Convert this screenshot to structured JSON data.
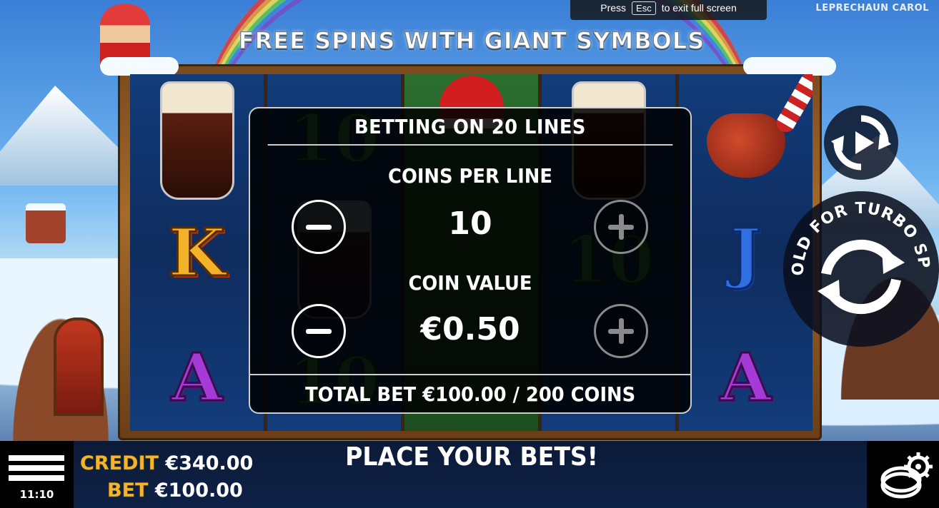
{
  "screen": {
    "brand": "LEPRECHAUN CAROL",
    "title": "FREE SPINS WITH GIANT SYMBOLS"
  },
  "fullscreen_hint": {
    "before": "Press",
    "key": "Esc",
    "after": "to exit full screen"
  },
  "reels": {
    "columns": [
      {
        "symbols": [
          "beer-glass",
          "K",
          "A"
        ]
      },
      {
        "symbols": [
          "10",
          "beer-glass",
          "10"
        ]
      },
      {
        "symbols": [
          "leprechaun-giant",
          "leprechaun-giant",
          "leprechaun-giant"
        ]
      },
      {
        "symbols": [
          "beer-glass",
          "10",
          "A"
        ]
      },
      {
        "symbols": [
          "pipe",
          "J",
          "A"
        ]
      }
    ],
    "letters": {
      "k": "K",
      "a1": "A",
      "j": "J",
      "a2": "A",
      "ten1": "10",
      "ten2": "10",
      "ten3": "10"
    }
  },
  "bet_panel": {
    "heading": "BETTING ON 20 LINES",
    "coins_per_line_label": "COINS PER LINE",
    "coins_per_line_value": "10",
    "coin_value_label": "COIN VALUE",
    "coin_value_value": "€0.50",
    "total_bet": "TOTAL BET €100.00 / 200 COINS"
  },
  "controls": {
    "turbo_spin_label": "HOLD FOR TURBO SPIN",
    "autoplay_icon": "autoplay-icon",
    "spin_icon": "spin-arrows-icon",
    "settings_icon": "coin-settings-icon",
    "menu_icon": "hamburger-menu-icon"
  },
  "status_bar": {
    "clock": "11:10",
    "credit_label": "CREDIT",
    "credit_value": "€340.00",
    "bet_label": "BET",
    "bet_value": "€100.00",
    "message": "PLACE YOUR BETS!"
  },
  "colors": {
    "gold_label": "#f3b52a",
    "panel_bg": "#000000",
    "panel_border": "#cfcfcf"
  }
}
